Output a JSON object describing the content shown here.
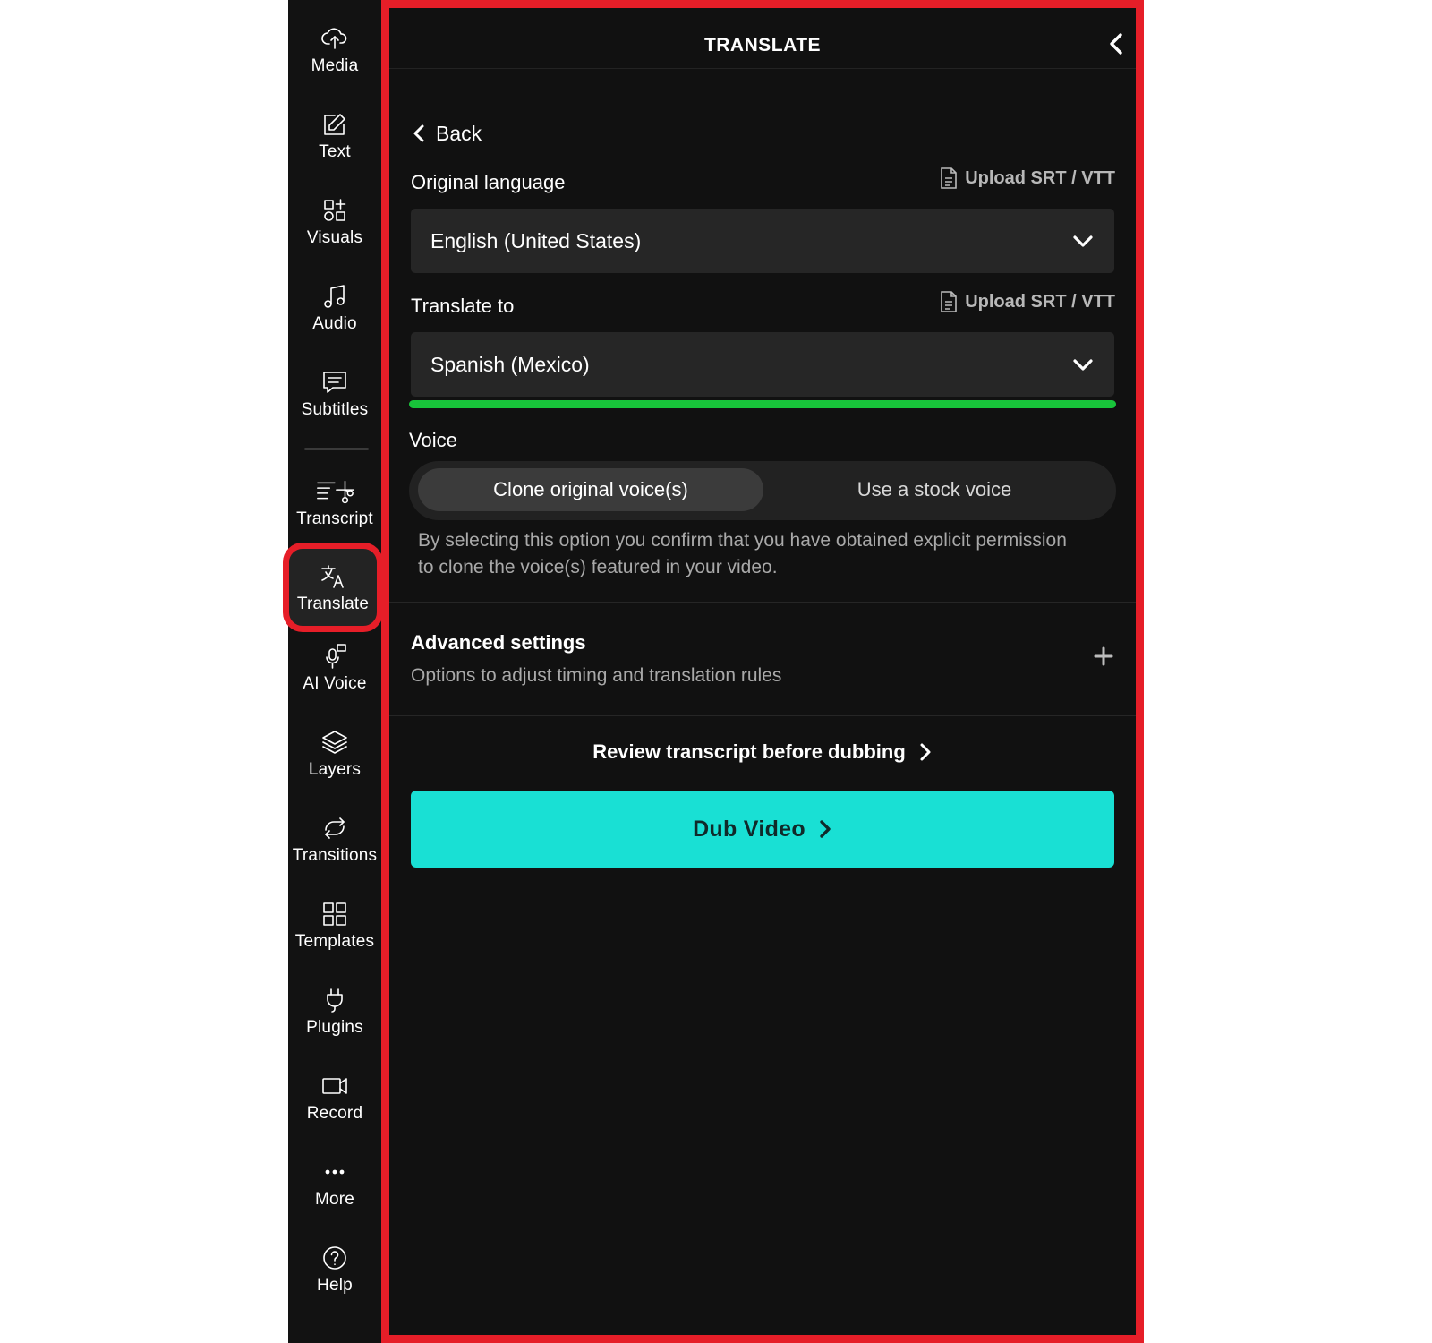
{
  "sidebar": {
    "items": [
      {
        "id": "media",
        "label": "Media",
        "icon": "upload-cloud-icon"
      },
      {
        "id": "text",
        "label": "Text",
        "icon": "edit-text-icon"
      },
      {
        "id": "visuals",
        "label": "Visuals",
        "icon": "shapes-plus-icon"
      },
      {
        "id": "audio",
        "label": "Audio",
        "icon": "music-note-icon"
      },
      {
        "id": "subtitles",
        "label": "Subtitles",
        "icon": "chat-lines-icon"
      },
      {
        "id": "transcript",
        "label": "Transcript",
        "icon": "transcript-scissors-icon"
      },
      {
        "id": "translate",
        "label": "Translate",
        "icon": "translate-icon"
      },
      {
        "id": "ai-voice",
        "label": "AI Voice",
        "icon": "microphone-icon"
      },
      {
        "id": "layers",
        "label": "Layers",
        "icon": "layers-icon"
      },
      {
        "id": "transitions",
        "label": "Transitions",
        "icon": "transitions-loop-icon"
      },
      {
        "id": "templates",
        "label": "Templates",
        "icon": "grid-icon"
      },
      {
        "id": "plugins",
        "label": "Plugins",
        "icon": "plug-icon"
      },
      {
        "id": "record",
        "label": "Record",
        "icon": "camera-icon"
      },
      {
        "id": "more",
        "label": "More",
        "icon": "more-dots-icon"
      },
      {
        "id": "help",
        "label": "Help",
        "icon": "help-circle-icon"
      }
    ],
    "active": "translate"
  },
  "panel": {
    "title": "TRANSLATE",
    "back_label": "Back",
    "original_language": {
      "label": "Original language",
      "upload_label": "Upload SRT / VTT",
      "value": "English (United States)"
    },
    "translate_to": {
      "label": "Translate to",
      "upload_label": "Upload SRT / VTT",
      "value": "Spanish (Mexico)"
    },
    "progress": 1.0,
    "voice": {
      "label": "Voice",
      "options": [
        "Clone original voice(s)",
        "Use a stock voice"
      ],
      "selected": "Clone original voice(s)",
      "disclaimer": "By selecting this option you confirm that you have obtained explicit permission to clone the voice(s) featured in your video."
    },
    "advanced": {
      "title": "Advanced settings",
      "subtitle": "Options to adjust timing and translation rules"
    },
    "review_label": "Review transcript before dubbing",
    "dub_label": "Dub Video"
  },
  "colors": {
    "accent_teal": "#19e0d4",
    "progress_green": "#18c43a",
    "highlight_red": "#e61e28",
    "panel_bg": "#111111"
  }
}
